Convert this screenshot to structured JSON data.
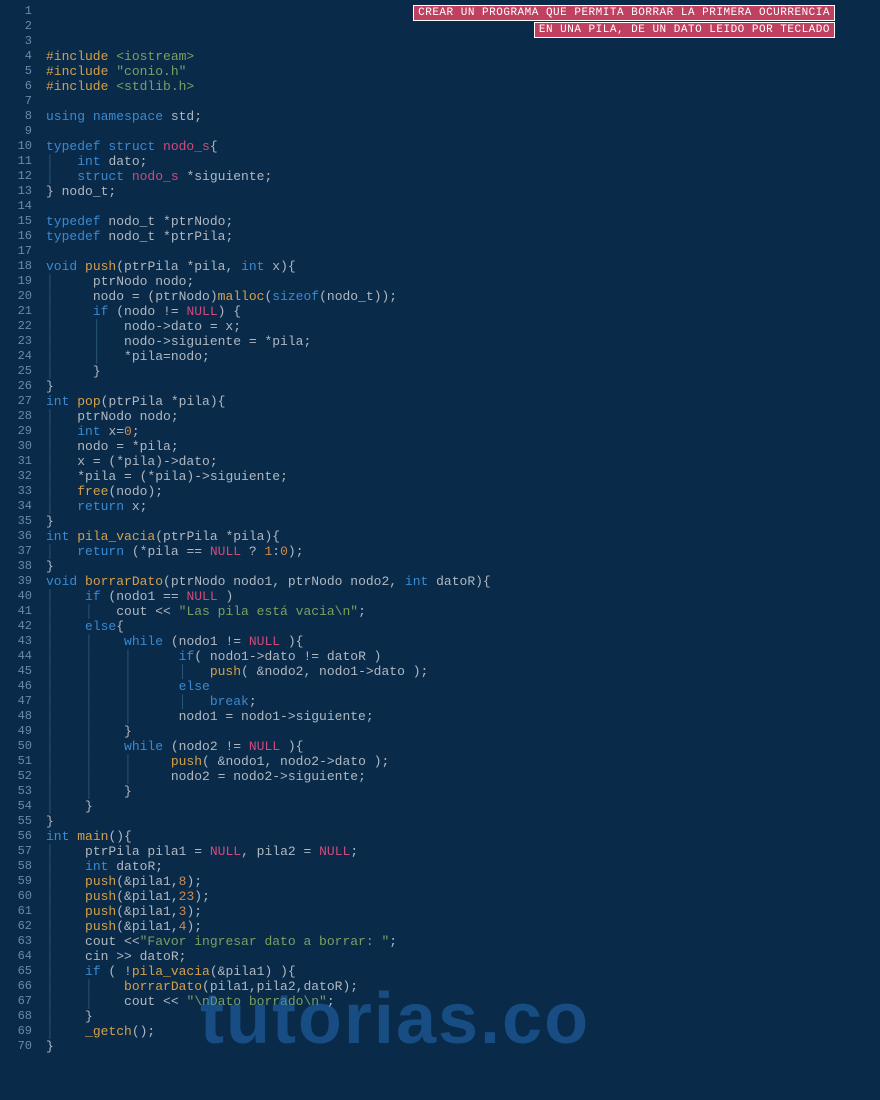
{
  "banner": {
    "line1": "CREAR UN PROGRAMA QUE PERMITA BORRAR LA PRIMERA OCURRENCIA",
    "line2": "EN UNA PILA, DE UN DATO LEIDO POR TECLADO"
  },
  "watermark": "tutorias.co",
  "lines": [
    {
      "n": 1,
      "t": []
    },
    {
      "n": 2,
      "t": []
    },
    {
      "n": 3,
      "t": []
    },
    {
      "n": 4,
      "t": [
        [
          "inc",
          "#include "
        ],
        [
          "str",
          "<iostream>"
        ]
      ]
    },
    {
      "n": 5,
      "t": [
        [
          "inc",
          "#include "
        ],
        [
          "str",
          "\"conio.h\""
        ]
      ]
    },
    {
      "n": 6,
      "t": [
        [
          "inc",
          "#include "
        ],
        [
          "str",
          "<stdlib.h>"
        ]
      ]
    },
    {
      "n": 7,
      "t": []
    },
    {
      "n": 8,
      "t": [
        [
          "kw",
          "using "
        ],
        [
          "kw",
          "namespace "
        ],
        [
          "ident",
          "std"
        ],
        [
          "op",
          ";"
        ]
      ]
    },
    {
      "n": 9,
      "t": []
    },
    {
      "n": 10,
      "t": [
        [
          "kw",
          "typedef "
        ],
        [
          "kw",
          "struct "
        ],
        [
          "null",
          "nodo_s"
        ],
        [
          "op",
          "{"
        ]
      ]
    },
    {
      "n": 11,
      "t": [
        [
          "guide",
          "│   "
        ],
        [
          "kw",
          "int "
        ],
        [
          "ident",
          "dato"
        ],
        [
          "op",
          ";"
        ]
      ]
    },
    {
      "n": 12,
      "t": [
        [
          "guide",
          "│   "
        ],
        [
          "kw",
          "struct "
        ],
        [
          "null",
          "nodo_s"
        ],
        [
          "ident",
          " *siguiente"
        ],
        [
          "op",
          ";"
        ]
      ]
    },
    {
      "n": 13,
      "t": [
        [
          "op",
          "} "
        ],
        [
          "ident",
          "nodo_t"
        ],
        [
          "op",
          ";"
        ]
      ]
    },
    {
      "n": 14,
      "t": []
    },
    {
      "n": 15,
      "t": [
        [
          "kw",
          "typedef "
        ],
        [
          "ident",
          "nodo_t *ptrNodo"
        ],
        [
          "op",
          ";"
        ]
      ]
    },
    {
      "n": 16,
      "t": [
        [
          "kw",
          "typedef "
        ],
        [
          "ident",
          "nodo_t *ptrPila"
        ],
        [
          "op",
          ";"
        ]
      ]
    },
    {
      "n": 17,
      "t": []
    },
    {
      "n": 18,
      "t": [
        [
          "kw",
          "void "
        ],
        [
          "func",
          "push"
        ],
        [
          "op",
          "("
        ],
        [
          "ident",
          "ptrPila *pila, "
        ],
        [
          "kw",
          "int "
        ],
        [
          "ident",
          "x"
        ],
        [
          "op",
          "){"
        ]
      ]
    },
    {
      "n": 19,
      "t": [
        [
          "guide",
          "│     "
        ],
        [
          "ident",
          "ptrNodo nodo"
        ],
        [
          "op",
          ";"
        ]
      ]
    },
    {
      "n": 20,
      "t": [
        [
          "guide",
          "│     "
        ],
        [
          "ident",
          "nodo = (ptrNodo)"
        ],
        [
          "func",
          "malloc"
        ],
        [
          "op",
          "("
        ],
        [
          "kw",
          "sizeof"
        ],
        [
          "op",
          "("
        ],
        [
          "ident",
          "nodo_t"
        ],
        [
          "op",
          "));"
        ]
      ]
    },
    {
      "n": 21,
      "t": [
        [
          "guide",
          "│     "
        ],
        [
          "kw",
          "if "
        ],
        [
          "op",
          "("
        ],
        [
          "ident",
          "nodo != "
        ],
        [
          "null",
          "NULL"
        ],
        [
          "op",
          ") {"
        ]
      ]
    },
    {
      "n": 22,
      "t": [
        [
          "guide",
          "│     │   "
        ],
        [
          "ident",
          "nodo->dato = x"
        ],
        [
          "op",
          ";"
        ]
      ]
    },
    {
      "n": 23,
      "t": [
        [
          "guide",
          "│     │   "
        ],
        [
          "ident",
          "nodo->siguiente = *pila"
        ],
        [
          "op",
          ";"
        ]
      ]
    },
    {
      "n": 24,
      "t": [
        [
          "guide",
          "│     │   "
        ],
        [
          "ident",
          "*pila=nodo"
        ],
        [
          "op",
          ";"
        ]
      ]
    },
    {
      "n": 25,
      "t": [
        [
          "guide",
          "│     "
        ],
        [
          "op",
          "}"
        ]
      ]
    },
    {
      "n": 26,
      "t": [
        [
          "op",
          "}"
        ]
      ]
    },
    {
      "n": 27,
      "t": [
        [
          "kw",
          "int "
        ],
        [
          "func",
          "pop"
        ],
        [
          "op",
          "("
        ],
        [
          "ident",
          "ptrPila *pila"
        ],
        [
          "op",
          "){"
        ]
      ]
    },
    {
      "n": 28,
      "t": [
        [
          "guide",
          "│   "
        ],
        [
          "ident",
          "ptrNodo nodo"
        ],
        [
          "op",
          ";"
        ]
      ]
    },
    {
      "n": 29,
      "t": [
        [
          "guide",
          "│   "
        ],
        [
          "kw",
          "int "
        ],
        [
          "ident",
          "x="
        ],
        [
          "num",
          "0"
        ],
        [
          "op",
          ";"
        ]
      ]
    },
    {
      "n": 30,
      "t": [
        [
          "guide",
          "│   "
        ],
        [
          "ident",
          "nodo = *pila"
        ],
        [
          "op",
          ";"
        ]
      ]
    },
    {
      "n": 31,
      "t": [
        [
          "guide",
          "│   "
        ],
        [
          "ident",
          "x = (*pila)->dato"
        ],
        [
          "op",
          ";"
        ]
      ]
    },
    {
      "n": 32,
      "t": [
        [
          "guide",
          "│   "
        ],
        [
          "ident",
          "*pila = (*pila)->siguiente"
        ],
        [
          "op",
          ";"
        ]
      ]
    },
    {
      "n": 33,
      "t": [
        [
          "guide",
          "│   "
        ],
        [
          "func",
          "free"
        ],
        [
          "op",
          "("
        ],
        [
          "ident",
          "nodo"
        ],
        [
          "op",
          ");"
        ]
      ]
    },
    {
      "n": 34,
      "t": [
        [
          "guide",
          "│   "
        ],
        [
          "kw",
          "return "
        ],
        [
          "ident",
          "x"
        ],
        [
          "op",
          ";"
        ]
      ]
    },
    {
      "n": 35,
      "t": [
        [
          "op",
          "}"
        ]
      ]
    },
    {
      "n": 36,
      "t": [
        [
          "kw",
          "int "
        ],
        [
          "func",
          "pila_vacia"
        ],
        [
          "op",
          "("
        ],
        [
          "ident",
          "ptrPila *pila"
        ],
        [
          "op",
          "){"
        ]
      ]
    },
    {
      "n": 37,
      "t": [
        [
          "guide",
          "│   "
        ],
        [
          "kw",
          "return "
        ],
        [
          "op",
          "("
        ],
        [
          "ident",
          "*pila == "
        ],
        [
          "null",
          "NULL"
        ],
        [
          "ident",
          " ? "
        ],
        [
          "num",
          "1"
        ],
        [
          "op",
          ":"
        ],
        [
          "num",
          "0"
        ],
        [
          "op",
          ");"
        ]
      ]
    },
    {
      "n": 38,
      "t": [
        [
          "op",
          "}"
        ]
      ]
    },
    {
      "n": 39,
      "t": [
        [
          "kw",
          "void "
        ],
        [
          "func",
          "borrarDato"
        ],
        [
          "op",
          "("
        ],
        [
          "ident",
          "ptrNodo nodo1, ptrNodo nodo2, "
        ],
        [
          "kw",
          "int "
        ],
        [
          "ident",
          "datoR"
        ],
        [
          "op",
          "){"
        ]
      ]
    },
    {
      "n": 40,
      "t": [
        [
          "guide",
          "│    "
        ],
        [
          "kw",
          "if "
        ],
        [
          "op",
          "("
        ],
        [
          "ident",
          "nodo1 == "
        ],
        [
          "null",
          "NULL "
        ],
        [
          "op",
          ")"
        ]
      ]
    },
    {
      "n": 41,
      "t": [
        [
          "guide",
          "│    │   "
        ],
        [
          "ident",
          "cout << "
        ],
        [
          "str",
          "\"Las pila está vacia\\n\""
        ],
        [
          "op",
          ";"
        ]
      ]
    },
    {
      "n": 42,
      "t": [
        [
          "guide",
          "│    "
        ],
        [
          "kw",
          "else"
        ],
        [
          "op",
          "{"
        ]
      ]
    },
    {
      "n": 43,
      "t": [
        [
          "guide",
          "│    │    "
        ],
        [
          "kw",
          "while "
        ],
        [
          "op",
          "("
        ],
        [
          "ident",
          "nodo1 != "
        ],
        [
          "null",
          "NULL "
        ],
        [
          "op",
          "){"
        ]
      ]
    },
    {
      "n": 44,
      "t": [
        [
          "guide",
          "│    │    │      "
        ],
        [
          "kw",
          "if"
        ],
        [
          "op",
          "( "
        ],
        [
          "ident",
          "nodo1->dato != datoR "
        ],
        [
          "op",
          ")"
        ]
      ]
    },
    {
      "n": 45,
      "t": [
        [
          "guide",
          "│    │    │      │   "
        ],
        [
          "func",
          "push"
        ],
        [
          "op",
          "( &"
        ],
        [
          "ident",
          "nodo2, nodo1->dato "
        ],
        [
          "op",
          ");"
        ]
      ]
    },
    {
      "n": 46,
      "t": [
        [
          "guide",
          "│    │    │      "
        ],
        [
          "kw",
          "else"
        ]
      ]
    },
    {
      "n": 47,
      "t": [
        [
          "guide",
          "│    │    │      │   "
        ],
        [
          "kw",
          "break"
        ],
        [
          "op",
          ";"
        ]
      ]
    },
    {
      "n": 48,
      "t": [
        [
          "guide",
          "│    │    │      "
        ],
        [
          "ident",
          "nodo1 = nodo1->siguiente"
        ],
        [
          "op",
          ";"
        ]
      ]
    },
    {
      "n": 49,
      "t": [
        [
          "guide",
          "│    │    "
        ],
        [
          "op",
          "}"
        ]
      ]
    },
    {
      "n": 50,
      "t": [
        [
          "guide",
          "│    │    "
        ],
        [
          "kw",
          "while "
        ],
        [
          "op",
          "("
        ],
        [
          "ident",
          "nodo2 != "
        ],
        [
          "null",
          "NULL "
        ],
        [
          "op",
          "){"
        ]
      ]
    },
    {
      "n": 51,
      "t": [
        [
          "guide",
          "│    │    │     "
        ],
        [
          "func",
          "push"
        ],
        [
          "op",
          "( &"
        ],
        [
          "ident",
          "nodo1, nodo2->dato "
        ],
        [
          "op",
          ");"
        ]
      ]
    },
    {
      "n": 52,
      "t": [
        [
          "guide",
          "│    │    │     "
        ],
        [
          "ident",
          "nodo2 = nodo2->siguiente"
        ],
        [
          "op",
          ";"
        ]
      ]
    },
    {
      "n": 53,
      "t": [
        [
          "guide",
          "│    │    "
        ],
        [
          "op",
          "}"
        ]
      ]
    },
    {
      "n": 54,
      "t": [
        [
          "guide",
          "│    "
        ],
        [
          "op",
          "}"
        ]
      ]
    },
    {
      "n": 55,
      "t": [
        [
          "op",
          "}"
        ]
      ]
    },
    {
      "n": 56,
      "t": [
        [
          "kw",
          "int "
        ],
        [
          "func",
          "main"
        ],
        [
          "op",
          "(){"
        ]
      ]
    },
    {
      "n": 57,
      "t": [
        [
          "guide",
          "│    "
        ],
        [
          "ident",
          "ptrPila pila1 = "
        ],
        [
          "null",
          "NULL"
        ],
        [
          "op",
          ", "
        ],
        [
          "ident",
          "pila2 = "
        ],
        [
          "null",
          "NULL"
        ],
        [
          "op",
          ";"
        ]
      ]
    },
    {
      "n": 58,
      "t": [
        [
          "guide",
          "│    "
        ],
        [
          "kw",
          "int "
        ],
        [
          "ident",
          "datoR"
        ],
        [
          "op",
          ";"
        ]
      ]
    },
    {
      "n": 59,
      "t": [
        [
          "guide",
          "│    "
        ],
        [
          "func",
          "push"
        ],
        [
          "op",
          "(&"
        ],
        [
          "ident",
          "pila1,"
        ],
        [
          "num",
          "8"
        ],
        [
          "op",
          ");"
        ]
      ]
    },
    {
      "n": 60,
      "t": [
        [
          "guide",
          "│    "
        ],
        [
          "func",
          "push"
        ],
        [
          "op",
          "(&"
        ],
        [
          "ident",
          "pila1,"
        ],
        [
          "num",
          "23"
        ],
        [
          "op",
          ");"
        ]
      ]
    },
    {
      "n": 61,
      "t": [
        [
          "guide",
          "│    "
        ],
        [
          "func",
          "push"
        ],
        [
          "op",
          "(&"
        ],
        [
          "ident",
          "pila1,"
        ],
        [
          "num",
          "3"
        ],
        [
          "op",
          ");"
        ]
      ]
    },
    {
      "n": 62,
      "t": [
        [
          "guide",
          "│    "
        ],
        [
          "func",
          "push"
        ],
        [
          "op",
          "(&"
        ],
        [
          "ident",
          "pila1,"
        ],
        [
          "num",
          "4"
        ],
        [
          "op",
          ");"
        ]
      ]
    },
    {
      "n": 63,
      "t": [
        [
          "guide",
          "│    "
        ],
        [
          "ident",
          "cout <<"
        ],
        [
          "str",
          "\"Favor ingresar dato a borrar: \""
        ],
        [
          "op",
          ";"
        ]
      ]
    },
    {
      "n": 64,
      "t": [
        [
          "guide",
          "│    "
        ],
        [
          "ident",
          "cin >> datoR"
        ],
        [
          "op",
          ";"
        ]
      ]
    },
    {
      "n": 65,
      "t": [
        [
          "guide",
          "│    "
        ],
        [
          "kw",
          "if "
        ],
        [
          "op",
          "( !"
        ],
        [
          "func",
          "pila_vacia"
        ],
        [
          "op",
          "(&"
        ],
        [
          "ident",
          "pila1"
        ],
        [
          "op",
          ") ){"
        ]
      ]
    },
    {
      "n": 66,
      "t": [
        [
          "guide",
          "│    │    "
        ],
        [
          "func",
          "borrarDato"
        ],
        [
          "op",
          "("
        ],
        [
          "ident",
          "pila1,pila2,datoR"
        ],
        [
          "op",
          ");"
        ]
      ]
    },
    {
      "n": 67,
      "t": [
        [
          "guide",
          "│    │    "
        ],
        [
          "ident",
          "cout << "
        ],
        [
          "str",
          "\"\\nDato borrado\\n\""
        ],
        [
          "op",
          ";"
        ]
      ]
    },
    {
      "n": 68,
      "t": [
        [
          "guide",
          "│    "
        ],
        [
          "op",
          "}"
        ]
      ]
    },
    {
      "n": 69,
      "t": [
        [
          "guide",
          "│    "
        ],
        [
          "func",
          "_getch"
        ],
        [
          "op",
          "();"
        ]
      ]
    },
    {
      "n": 70,
      "t": [
        [
          "op",
          "}"
        ]
      ]
    }
  ]
}
